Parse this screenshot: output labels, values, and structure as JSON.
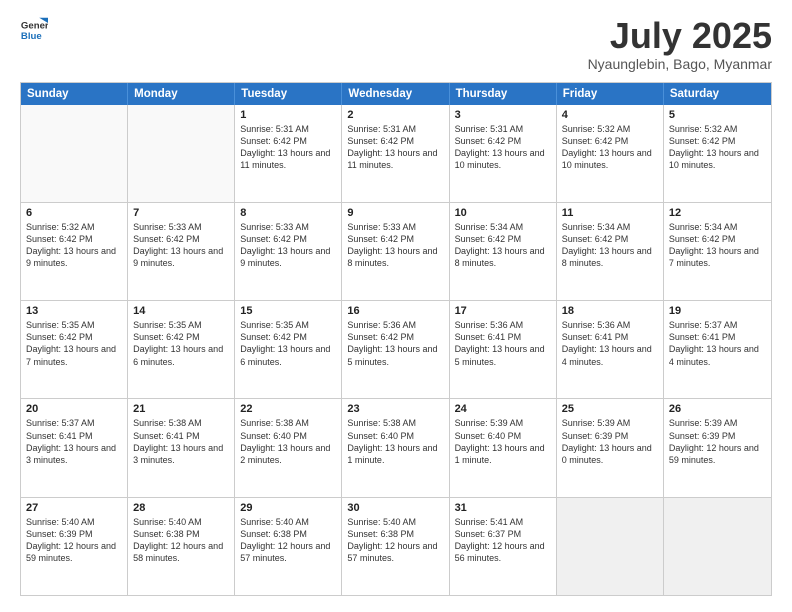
{
  "logo": {
    "line1": "General",
    "line2": "Blue"
  },
  "header": {
    "month": "July 2025",
    "location": "Nyaunglebin, Bago, Myanmar"
  },
  "weekdays": [
    "Sunday",
    "Monday",
    "Tuesday",
    "Wednesday",
    "Thursday",
    "Friday",
    "Saturday"
  ],
  "rows": [
    [
      {
        "day": "",
        "text": ""
      },
      {
        "day": "",
        "text": ""
      },
      {
        "day": "1",
        "text": "Sunrise: 5:31 AM\nSunset: 6:42 PM\nDaylight: 13 hours and 11 minutes."
      },
      {
        "day": "2",
        "text": "Sunrise: 5:31 AM\nSunset: 6:42 PM\nDaylight: 13 hours and 11 minutes."
      },
      {
        "day": "3",
        "text": "Sunrise: 5:31 AM\nSunset: 6:42 PM\nDaylight: 13 hours and 10 minutes."
      },
      {
        "day": "4",
        "text": "Sunrise: 5:32 AM\nSunset: 6:42 PM\nDaylight: 13 hours and 10 minutes."
      },
      {
        "day": "5",
        "text": "Sunrise: 5:32 AM\nSunset: 6:42 PM\nDaylight: 13 hours and 10 minutes."
      }
    ],
    [
      {
        "day": "6",
        "text": "Sunrise: 5:32 AM\nSunset: 6:42 PM\nDaylight: 13 hours and 9 minutes."
      },
      {
        "day": "7",
        "text": "Sunrise: 5:33 AM\nSunset: 6:42 PM\nDaylight: 13 hours and 9 minutes."
      },
      {
        "day": "8",
        "text": "Sunrise: 5:33 AM\nSunset: 6:42 PM\nDaylight: 13 hours and 9 minutes."
      },
      {
        "day": "9",
        "text": "Sunrise: 5:33 AM\nSunset: 6:42 PM\nDaylight: 13 hours and 8 minutes."
      },
      {
        "day": "10",
        "text": "Sunrise: 5:34 AM\nSunset: 6:42 PM\nDaylight: 13 hours and 8 minutes."
      },
      {
        "day": "11",
        "text": "Sunrise: 5:34 AM\nSunset: 6:42 PM\nDaylight: 13 hours and 8 minutes."
      },
      {
        "day": "12",
        "text": "Sunrise: 5:34 AM\nSunset: 6:42 PM\nDaylight: 13 hours and 7 minutes."
      }
    ],
    [
      {
        "day": "13",
        "text": "Sunrise: 5:35 AM\nSunset: 6:42 PM\nDaylight: 13 hours and 7 minutes."
      },
      {
        "day": "14",
        "text": "Sunrise: 5:35 AM\nSunset: 6:42 PM\nDaylight: 13 hours and 6 minutes."
      },
      {
        "day": "15",
        "text": "Sunrise: 5:35 AM\nSunset: 6:42 PM\nDaylight: 13 hours and 6 minutes."
      },
      {
        "day": "16",
        "text": "Sunrise: 5:36 AM\nSunset: 6:42 PM\nDaylight: 13 hours and 5 minutes."
      },
      {
        "day": "17",
        "text": "Sunrise: 5:36 AM\nSunset: 6:41 PM\nDaylight: 13 hours and 5 minutes."
      },
      {
        "day": "18",
        "text": "Sunrise: 5:36 AM\nSunset: 6:41 PM\nDaylight: 13 hours and 4 minutes."
      },
      {
        "day": "19",
        "text": "Sunrise: 5:37 AM\nSunset: 6:41 PM\nDaylight: 13 hours and 4 minutes."
      }
    ],
    [
      {
        "day": "20",
        "text": "Sunrise: 5:37 AM\nSunset: 6:41 PM\nDaylight: 13 hours and 3 minutes."
      },
      {
        "day": "21",
        "text": "Sunrise: 5:38 AM\nSunset: 6:41 PM\nDaylight: 13 hours and 3 minutes."
      },
      {
        "day": "22",
        "text": "Sunrise: 5:38 AM\nSunset: 6:40 PM\nDaylight: 13 hours and 2 minutes."
      },
      {
        "day": "23",
        "text": "Sunrise: 5:38 AM\nSunset: 6:40 PM\nDaylight: 13 hours and 1 minute."
      },
      {
        "day": "24",
        "text": "Sunrise: 5:39 AM\nSunset: 6:40 PM\nDaylight: 13 hours and 1 minute."
      },
      {
        "day": "25",
        "text": "Sunrise: 5:39 AM\nSunset: 6:39 PM\nDaylight: 13 hours and 0 minutes."
      },
      {
        "day": "26",
        "text": "Sunrise: 5:39 AM\nSunset: 6:39 PM\nDaylight: 12 hours and 59 minutes."
      }
    ],
    [
      {
        "day": "27",
        "text": "Sunrise: 5:40 AM\nSunset: 6:39 PM\nDaylight: 12 hours and 59 minutes."
      },
      {
        "day": "28",
        "text": "Sunrise: 5:40 AM\nSunset: 6:38 PM\nDaylight: 12 hours and 58 minutes."
      },
      {
        "day": "29",
        "text": "Sunrise: 5:40 AM\nSunset: 6:38 PM\nDaylight: 12 hours and 57 minutes."
      },
      {
        "day": "30",
        "text": "Sunrise: 5:40 AM\nSunset: 6:38 PM\nDaylight: 12 hours and 57 minutes."
      },
      {
        "day": "31",
        "text": "Sunrise: 5:41 AM\nSunset: 6:37 PM\nDaylight: 12 hours and 56 minutes."
      },
      {
        "day": "",
        "text": ""
      },
      {
        "day": "",
        "text": ""
      }
    ]
  ]
}
